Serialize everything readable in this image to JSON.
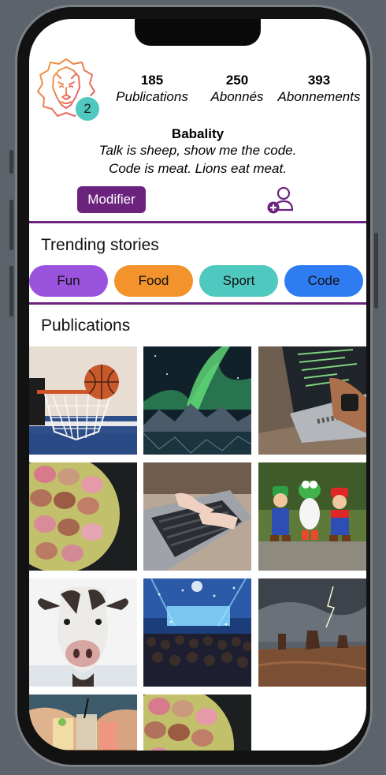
{
  "profile": {
    "badge_count": "2",
    "stats": [
      {
        "value": "185",
        "label": "Publications"
      },
      {
        "value": "250",
        "label": "Abonnés"
      },
      {
        "value": "393",
        "label": "Abonnements"
      }
    ],
    "username": "Babality",
    "bio_line1": "Talk is sheep, show me the code.",
    "bio_line2": "Code is meat. Lions eat meat.",
    "edit_button": "Modifier"
  },
  "stories": {
    "title": "Trending stories",
    "items": [
      {
        "label": "Fun",
        "color": "#9a53dc"
      },
      {
        "label": "Food",
        "color": "#f2932b"
      },
      {
        "label": "Sport",
        "color": "#4fc8bf"
      },
      {
        "label": "Code",
        "color": "#2f7cf2"
      }
    ]
  },
  "publications": {
    "title": "Publications",
    "images": [
      "basketball-hoop",
      "aurora-mountains",
      "laptop-coding",
      "macarons-plate",
      "typing-laptop",
      "mario-yoshi-luigi-figures",
      "cow-portrait",
      "concert-crowd",
      "desert-storm",
      "cocktails-toast",
      "macarons-plate"
    ]
  },
  "theme": {
    "accent": "#6b237e",
    "avatar_badge": "#4fc8bf"
  }
}
